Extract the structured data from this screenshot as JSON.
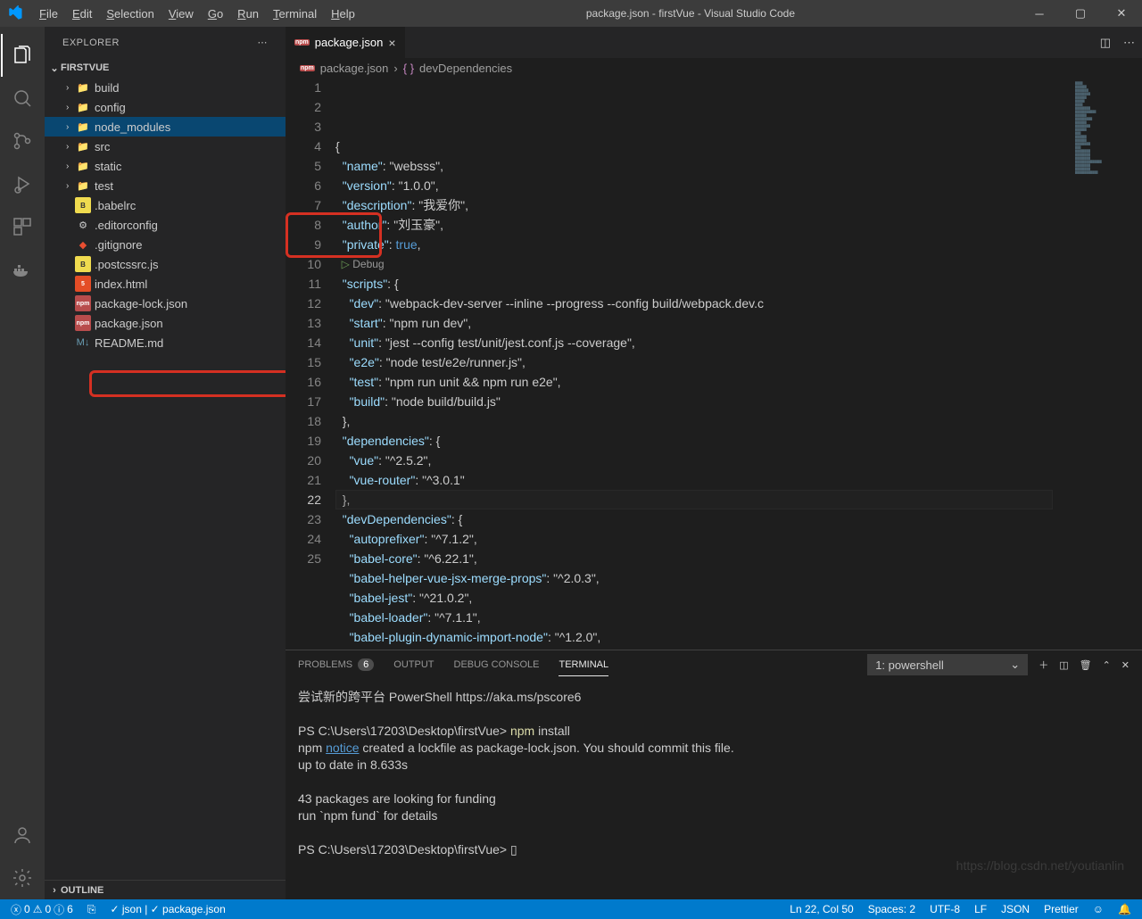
{
  "title": "package.json - firstVue - Visual Studio Code",
  "menu": [
    "File",
    "Edit",
    "Selection",
    "View",
    "Go",
    "Run",
    "Terminal",
    "Help"
  ],
  "explorer": {
    "header": "EXPLORER",
    "project": "FIRSTVUE",
    "outline": "OUTLINE",
    "items": [
      {
        "kind": "folder",
        "name": "build",
        "icon": "folder"
      },
      {
        "kind": "folder",
        "name": "config",
        "icon": "folder"
      },
      {
        "kind": "folder",
        "name": "node_modules",
        "icon": "nm",
        "selected": true
      },
      {
        "kind": "folder",
        "name": "src",
        "icon": "folder"
      },
      {
        "kind": "folder",
        "name": "static",
        "icon": "folder"
      },
      {
        "kind": "folder",
        "name": "test",
        "icon": "folder"
      },
      {
        "kind": "file",
        "name": ".babelrc",
        "icon": "js"
      },
      {
        "kind": "file",
        "name": ".editorconfig",
        "icon": "gear"
      },
      {
        "kind": "file",
        "name": ".gitignore",
        "icon": "git"
      },
      {
        "kind": "file",
        "name": ".postcssrc.js",
        "icon": "js"
      },
      {
        "kind": "file",
        "name": "index.html",
        "icon": "html"
      },
      {
        "kind": "file",
        "name": "package-lock.json",
        "icon": "json",
        "annot": true
      },
      {
        "kind": "file",
        "name": "package.json",
        "icon": "json"
      },
      {
        "kind": "file",
        "name": "README.md",
        "icon": "md"
      }
    ]
  },
  "tab": {
    "name": "package.json"
  },
  "breadcrumb": {
    "file": "package.json",
    "symbol": "devDependencies"
  },
  "code": {
    "lines_total": 25,
    "current_line": 22,
    "lines": [
      "{",
      "  \"name\": \"websss\",",
      "  \"version\": \"1.0.0\",",
      "  \"description\": \"我爱你\",",
      "  \"author\": \"刘玉豪\",",
      "  \"private\": true,",
      "  ▷ Debug",
      "  \"scripts\": {",
      "    \"dev\": \"webpack-dev-server --inline --progress --config build/webpack.dev.c",
      "    \"start\": \"npm run dev\",",
      "    \"unit\": \"jest --config test/unit/jest.conf.js --coverage\",",
      "    \"e2e\": \"node test/e2e/runner.js\",",
      "    \"test\": \"npm run unit && npm run e2e\",",
      "    \"build\": \"node build/build.js\"",
      "  },",
      "  \"dependencies\": {",
      "    \"vue\": \"^2.5.2\",",
      "    \"vue-router\": \"^3.0.1\"",
      "  },",
      "  \"devDependencies\": {",
      "    \"autoprefixer\": \"^7.1.2\",",
      "    \"babel-core\": \"^6.22.1\",",
      "    \"babel-helper-vue-jsx-merge-props\": \"^2.0.3\",",
      "    \"babel-jest\": \"^21.0.2\",",
      "    \"babel-loader\": \"^7.1.1\",",
      "    \"babel-plugin-dynamic-import-node\": \"^1.2.0\","
    ]
  },
  "panel": {
    "tabs": {
      "problems": "PROBLEMS",
      "problems_count": "6",
      "output": "OUTPUT",
      "debug": "DEBUG CONSOLE",
      "terminal": "TERMINAL"
    },
    "select": "1: powershell"
  },
  "terminal": [
    "尝试新的跨平台 PowerShell https://aka.ms/pscore6",
    "",
    "PS C:\\Users\\17203\\Desktop\\firstVue> npm install",
    "npm notice created a lockfile as package-lock.json. You should commit this file.",
    "up to date in 8.633s",
    "",
    "43 packages are looking for funding",
    "  run `npm fund` for details",
    "",
    "PS C:\\Users\\17203\\Desktop\\firstVue> ▯"
  ],
  "status": {
    "errors": "0",
    "warnings": "0",
    "infos": "6",
    "schema": "✓ json | ✓ package.json",
    "pos": "Ln 22, Col 50",
    "spaces": "Spaces: 2",
    "enc": "UTF-8",
    "eol": "LF",
    "lang": "JSON",
    "prettier": "Prettier",
    "bell": "🔔"
  },
  "watermark": "https://blog.csdn.net/youtianlin"
}
